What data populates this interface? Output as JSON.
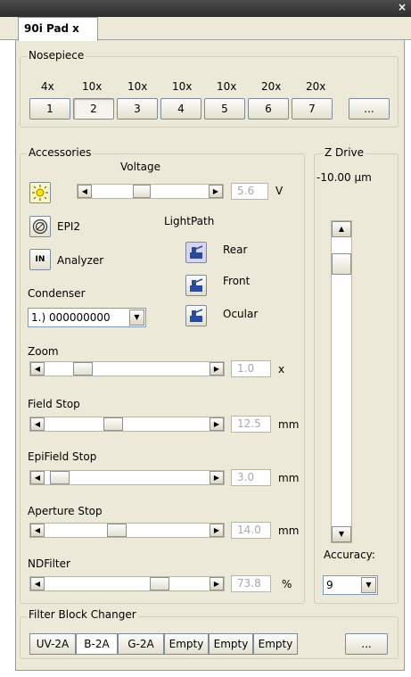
{
  "window": {
    "close_glyph": "×"
  },
  "tab": {
    "label": "90i Pad",
    "close": "x"
  },
  "nosepiece": {
    "legend": "Nosepiece",
    "objectives": [
      "4x",
      "10x",
      "10x",
      "10x",
      "10x",
      "20x",
      "20x"
    ],
    "buttons": [
      "1",
      "2",
      "3",
      "4",
      "5",
      "6",
      "7"
    ],
    "selected": "2",
    "more_label": "..."
  },
  "accessories": {
    "legend": "Accessories",
    "voltage": {
      "label": "Voltage",
      "value": "5.6",
      "unit": "V"
    },
    "lamp_icon": "lamp-icon",
    "epi": {
      "label": "EPI2"
    },
    "analyzer": {
      "badge": "IN",
      "label": "Analyzer"
    },
    "lightpath": {
      "label": "LightPath",
      "options": [
        "Rear",
        "Front",
        "Ocular"
      ]
    },
    "condenser": {
      "label": "Condenser",
      "value": "1.) 000000000"
    },
    "zoom": {
      "label": "Zoom",
      "value": "1.0",
      "unit": "x"
    },
    "field_stop": {
      "label": "Field Stop",
      "value": "12.5",
      "unit": "mm"
    },
    "epifield_stop": {
      "label": "EpiField Stop",
      "value": "3.0",
      "unit": "mm"
    },
    "aperture_stop": {
      "label": "Aperture Stop",
      "value": "14.0",
      "unit": "mm"
    },
    "ndfilter": {
      "label": "NDFilter",
      "value": "73.8",
      "unit": "%"
    }
  },
  "zdrive": {
    "legend": "Z Drive",
    "position": "-10.00 µm",
    "accuracy_label": "Accuracy:",
    "accuracy_value": "9"
  },
  "filter_block": {
    "legend": "Filter Block Changer",
    "filters": [
      "UV-2A",
      "B-2A",
      "G-2A",
      "Empty",
      "Empty",
      "Empty"
    ],
    "selected": "B-2A",
    "more_label": "..."
  }
}
